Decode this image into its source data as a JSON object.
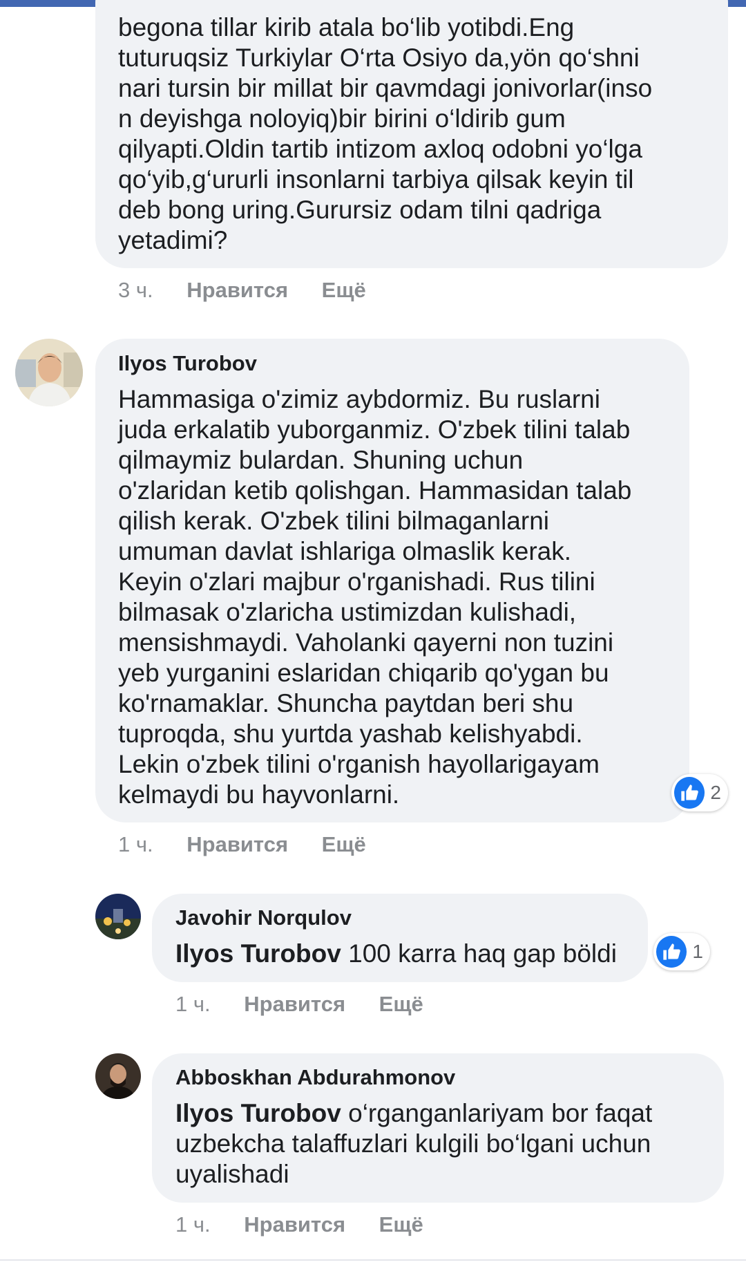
{
  "comments": [
    {
      "text_lines": [
        "begona tillar kirib atala bo‘lib yotibdi.Eng",
        "tuturuqsiz Turkiylar O‘rta Osiyo da,yön qo‘shni",
        "nari tursin bir millat bir qavmdagi jonivorlar(inso",
        "n deyishga noloyiq)bir birini o‘ldirib gum",
        "qilyapti.Oldin tartib intizom axloq odobni yo‘lga",
        "qo‘yib,g‘ururli insonlarni tarbiya qilsak keyin til",
        "deb bong uring.Gurursiz odam tilni qadriga",
        "yetadimi?"
      ],
      "time": "3 ч.",
      "like_label": "Нравится",
      "more_label": "Ещё"
    },
    {
      "author": "Ilyos Turobov",
      "text_lines": [
        "Hammasiga o'zimiz aybdormiz. Bu ruslarni",
        "juda erkalatib yuborganmiz. O'zbek tilini talab",
        "qilmaymiz bulardan. Shuning uchun",
        "o'zlaridan ketib qolishgan. Hammasidan talab",
        "qilish kerak. O'zbek tilini bilmaganlarni",
        "umuman davlat ishlariga olmaslik kerak.",
        "Keyin o'zlari majbur o'rganishadi. Rus tilini",
        "bilmasak o'zlaricha ustimizdan kulishadi,",
        "mensishmaydi. Vaholanki qayerni non tuzini",
        "yeb yurganini eslaridan chiqarib qo'ygan bu",
        "ko'rnamaklar. Shuncha paytdan beri shu",
        "tuproqda, shu yurtda yashab kelishyabdi.",
        "Lekin o'zbek tilini o'rganish hayollarigayam",
        "kelmaydi bu hayvonlarni."
      ],
      "reaction_count": "2",
      "time": "1 ч.",
      "like_label": "Нравится",
      "more_label": "Ещё",
      "icon": "thumbs-up-icon",
      "reaction_color": "#1877f2"
    }
  ],
  "replies": [
    {
      "author": "Javohir Norqulov",
      "mention": "Ilyos Turobov",
      "text_lines": [
        " 100 karra haq gap böldi"
      ],
      "reaction_count": "1",
      "time": "1 ч.",
      "like_label": "Нравится",
      "more_label": "Ещё"
    },
    {
      "author": "Abboskhan Abdurahmonov",
      "mention": "Ilyos Turobov",
      "text_lines": [
        " o‘rganganlariyam bor faqat",
        "uzbekcha talaffuzlari kulgili bo‘lgani uchun",
        "uyalishadi"
      ],
      "time": "1 ч.",
      "like_label": "Нравится",
      "more_label": "Ещё"
    }
  ],
  "colors": {
    "bubble": "#f0f2f5",
    "meta_text": "#8a8d91",
    "top_bar": "#4267b2"
  }
}
